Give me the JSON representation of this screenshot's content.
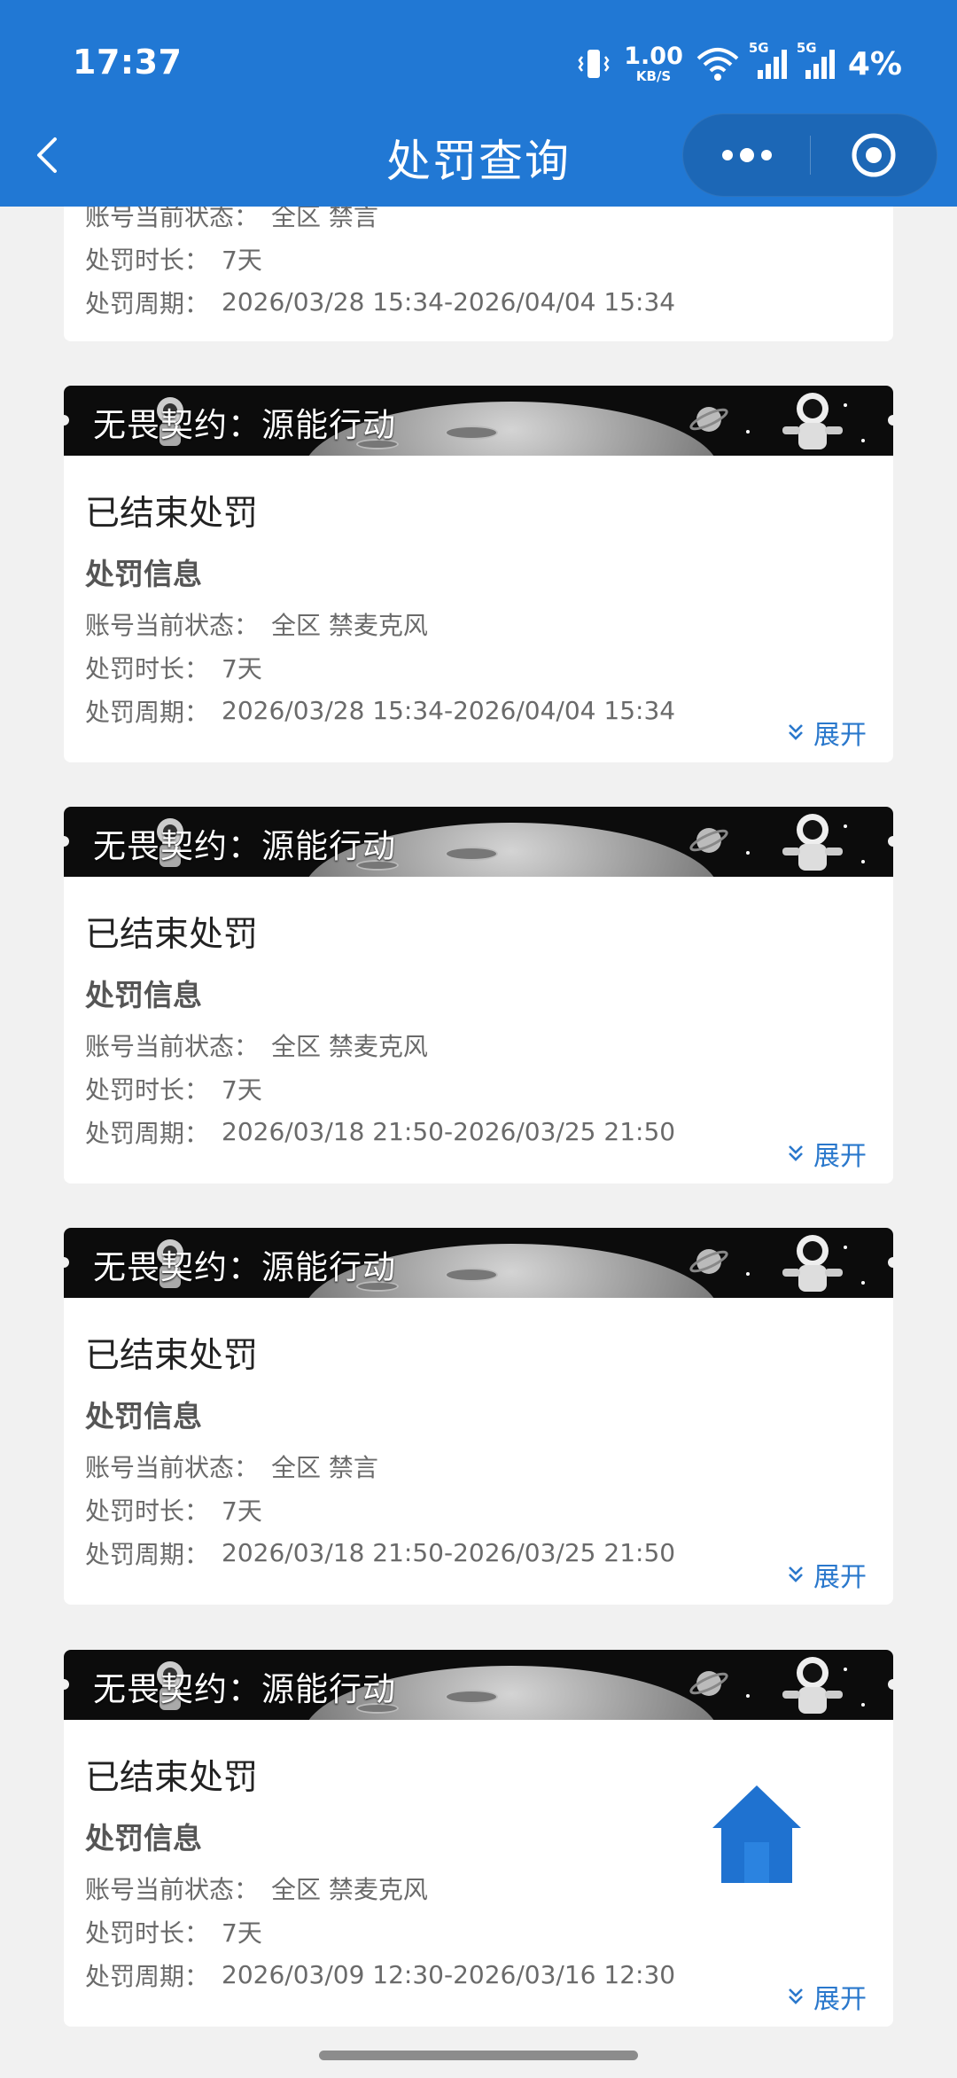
{
  "status_bar": {
    "time": "17:37",
    "net_speed_value": "1.00",
    "net_speed_unit": "KB/S",
    "signal1_label": "5G",
    "signal2_label": "5G",
    "battery": "4%"
  },
  "header": {
    "title": "处罚查询",
    "back_icon": "chevron-left-icon",
    "more_icon": "more-dots-icon",
    "close_icon": "target-close-icon"
  },
  "colors": {
    "primary": "#2178d4",
    "link": "#2a78cc",
    "background": "#f1f1f1"
  },
  "labels": {
    "section_title": "处罚信息",
    "status_label": "账号当前状态：",
    "duration_label": "处罚时长：",
    "period_label": "处罚周期：",
    "expand": "展开",
    "banner": "无畏契约：源能行动"
  },
  "records": [
    {
      "banner": "",
      "status": "",
      "account_state": "全区 禁言",
      "duration": "7天",
      "period": "2026/03/28 15:34-2026/04/04 15:34"
    },
    {
      "banner": "无畏契约：源能行动",
      "status": "已结束处罚",
      "account_state": "全区 禁麦克风",
      "duration": "7天",
      "period": "2026/03/28 15:34-2026/04/04 15:34"
    },
    {
      "banner": "无畏契约：源能行动",
      "status": "已结束处罚",
      "account_state": "全区 禁麦克风",
      "duration": "7天",
      "period": "2026/03/18 21:50-2026/03/25 21:50"
    },
    {
      "banner": "无畏契约：源能行动",
      "status": "已结束处罚",
      "account_state": "全区 禁言",
      "duration": "7天",
      "period": "2026/03/18 21:50-2026/03/25 21:50"
    },
    {
      "banner": "无畏契约：源能行动",
      "status": "已结束处罚",
      "account_state": "全区 禁麦克风",
      "duration": "7天",
      "period": "2026/03/09 12:30-2026/03/16 12:30"
    }
  ],
  "floating": {
    "home_icon": "home-icon"
  }
}
